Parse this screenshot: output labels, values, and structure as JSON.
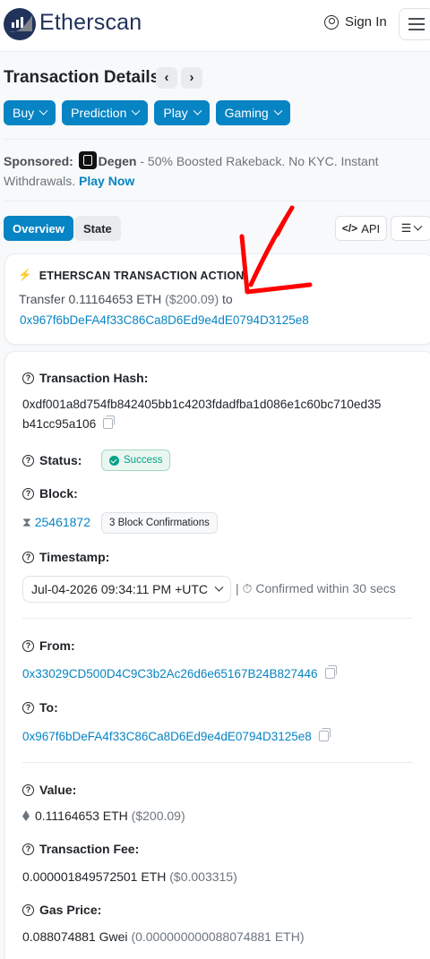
{
  "header": {
    "brand": "Etherscan",
    "sign_in": "Sign In"
  },
  "page": {
    "title": "Transaction Details",
    "prev": "‹",
    "next": "›"
  },
  "pills": [
    {
      "label": "Buy"
    },
    {
      "label": "Prediction"
    },
    {
      "label": "Play"
    },
    {
      "label": "Gaming"
    }
  ],
  "sponsored": {
    "prefix": "Sponsored:",
    "brand": "Degen",
    "text": " - 50% Boosted Rakeback. No KYC. Instant Withdrawals.",
    "cta": "Play Now"
  },
  "tabs": {
    "overview": "Overview",
    "state": "State",
    "api": "API"
  },
  "action": {
    "title": "ETHERSCAN TRANSACTION ACTION",
    "text": "Transfer 0.11164653 ETH",
    "usd": "($200.09)",
    "to": "to",
    "address": "0x967f6bDeFA4f33C86Ca8D6Ed9e4dE0794D3125e8"
  },
  "details": {
    "hash_label": "Transaction Hash:",
    "hash_line1": "0xdf001a8d754fb842405bb1c4203fdadfba1d086e1c60bc710ed35",
    "hash_line2": "b41cc95a106",
    "status_label": "Status:",
    "status": "Success",
    "block_label": "Block:",
    "block": "25461872",
    "confirmations": "3 Block Confirmations",
    "timestamp_label": "Timestamp:",
    "timestamp": "Jul-04-2026 09:34:11 PM +UTC",
    "confirmed": "| ⏱ Confirmed within 30 secs",
    "from_label": "From:",
    "from": "0x33029CD500D4C9C3b2Ac26d6e65167B24B827446",
    "to_label": "To:",
    "to": "0x967f6bDeFA4f33C86Ca8D6Ed9e4dE0794D3125e8",
    "value_label": "Value:",
    "value": "0.11164653 ETH",
    "value_usd": "($200.09)",
    "fee_label": "Transaction Fee:",
    "fee": "0.000001849572501 ETH",
    "fee_usd": "($0.003315)",
    "gas_label": "Gas Price:",
    "gas": "0.088074881 Gwei",
    "gas_eth": "(0.000000000088074881 ETH)"
  },
  "colors": {
    "accent": "#0784c3",
    "brand_dark": "#21325b",
    "success": "#00a186",
    "annotation": "#ff0000"
  }
}
